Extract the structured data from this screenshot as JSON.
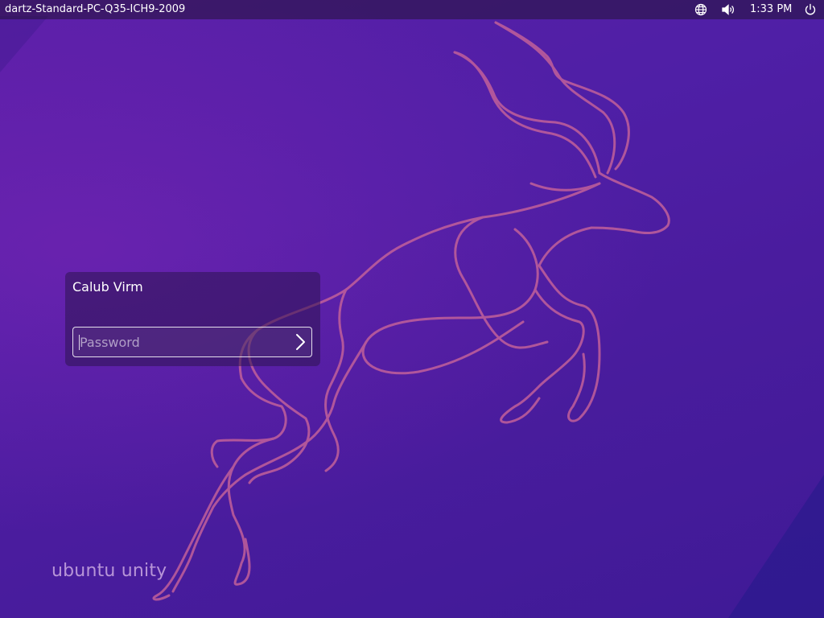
{
  "top_panel": {
    "hostname": "dartz-Standard-PC-Q35-ICH9-2009",
    "clock": "1:33 PM",
    "icons": [
      "network-globe-icon",
      "volume-icon",
      "power-icon"
    ]
  },
  "login": {
    "user_name": "Calub Virm",
    "password_placeholder": "Password",
    "password_value": "",
    "submit_icon": "chevron-right-icon"
  },
  "branding": {
    "text": "ubuntu unity"
  },
  "colors": {
    "background": "#4f1fa6",
    "panel": "#23123799",
    "gazelle_outline": "#c2609a",
    "text": "#ffffff"
  }
}
